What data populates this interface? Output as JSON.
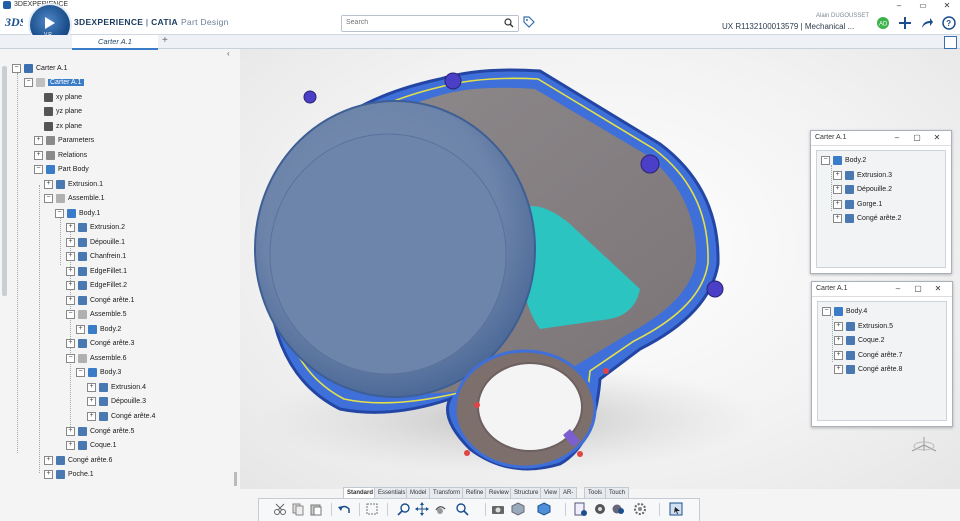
{
  "os_window": {
    "title": "3DEXPERIENCE",
    "minimize": "–",
    "restore": "▭",
    "close": "✕"
  },
  "app": {
    "brand": "3DEXPERIENCE",
    "separator": " | ",
    "product": "CATIA",
    "workbench": "Part Design",
    "compass_label": "V,R"
  },
  "search": {
    "placeholder": "Search"
  },
  "user": {
    "name": "Alain DUGOUSSET",
    "doc_id": "UX R1132100013579 | Mechanical ..."
  },
  "tabs": [
    {
      "label": "Carter A.1"
    }
  ],
  "tab_add": "+",
  "tree": {
    "root": "Carter A.1",
    "selected": "Carter A.1",
    "planes": [
      "xy plane",
      "yz plane",
      "zx plane"
    ],
    "parameters": "Parameters",
    "relations": "Relations",
    "part_body": "Part Body",
    "extrusion1": "Extrusion.1",
    "assemble1": "Assemble.1",
    "body1": "Body.1",
    "body1_items": [
      "Extrusion.2",
      "Dépouille.1",
      "Chanfrein.1",
      "EdgeFillet.1",
      "EdgeFillet.2",
      "Congé arête.1"
    ],
    "assemble5": "Assemble.5",
    "body2": "Body.2",
    "conge3": "Congé arête.3",
    "assemble6": "Assemble.6",
    "body3": "Body.3",
    "body3_items": [
      "Extrusion.4",
      "Dépouille.3",
      "Congé arête.4"
    ],
    "conge5": "Congé arête.5",
    "coque1": "Coque.1",
    "conge6": "Congé arête.6",
    "poche1": "Poche.1"
  },
  "panel1": {
    "title": "Carter A.1",
    "root": "Body.2",
    "items": [
      "Extrusion.3",
      "Dépouille.2",
      "Gorge.1",
      "Congé arête.2"
    ]
  },
  "panel2": {
    "title": "Carter A.1",
    "root": "Body.4",
    "items": [
      "Extrusion.5",
      "Coque.2",
      "Congé arête.7",
      "Congé arête.8"
    ]
  },
  "ribbon_tabs": [
    "Standard",
    "Essentials",
    "Model",
    "Transform",
    "Refine",
    "Review",
    "Structure",
    "View",
    "AR-VR",
    "Tools",
    "Touch"
  ],
  "ribbon_active": "Standard",
  "colors": {
    "accent": "#3a7cc7",
    "brand": "#1b4f8c",
    "part_blue": "#3f6fd8",
    "part_grey": "#8c96a3",
    "part_cyan": "#2bc4c0",
    "edge_yellow": "#e3e04a"
  },
  "icons": [
    "3ds-logo-icon",
    "compass-icon",
    "search-icon",
    "tag-icon",
    "collab-icon",
    "plus-icon",
    "share-icon",
    "help-icon",
    "fit-all-icon",
    "robot-icon"
  ]
}
